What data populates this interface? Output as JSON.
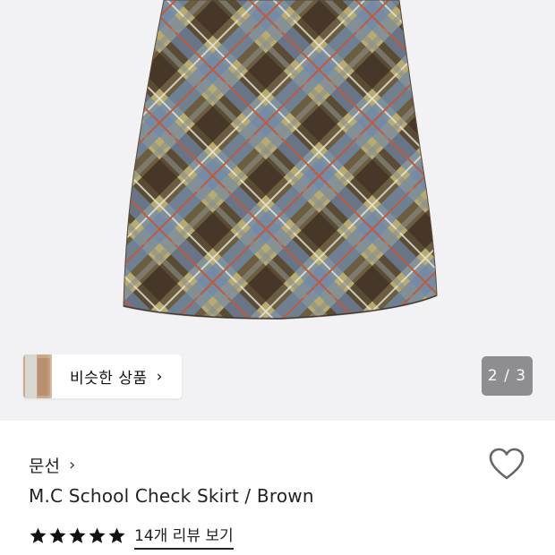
{
  "gallery": {
    "similar_products_label": "비슷한 상품",
    "similar_products_arrow": "›",
    "page_indicator": "2 / 3"
  },
  "product": {
    "brand": "문선",
    "brand_arrow": "›",
    "name": "M.C School Check Skirt / Brown",
    "rating_stars": 5,
    "review_link": "14개 리뷰 보기"
  },
  "colors": {
    "gallery_bg": "#f2f2f4",
    "plaid_base": "#b7ab72",
    "plaid_dark": "#3a2a20",
    "plaid_blue": "#6f88a8",
    "plaid_red": "#c05a3a",
    "indicator_bg": "#8e8e90"
  },
  "icons": {
    "favorite": "heart-outline-icon",
    "star": "star-filled-icon"
  }
}
